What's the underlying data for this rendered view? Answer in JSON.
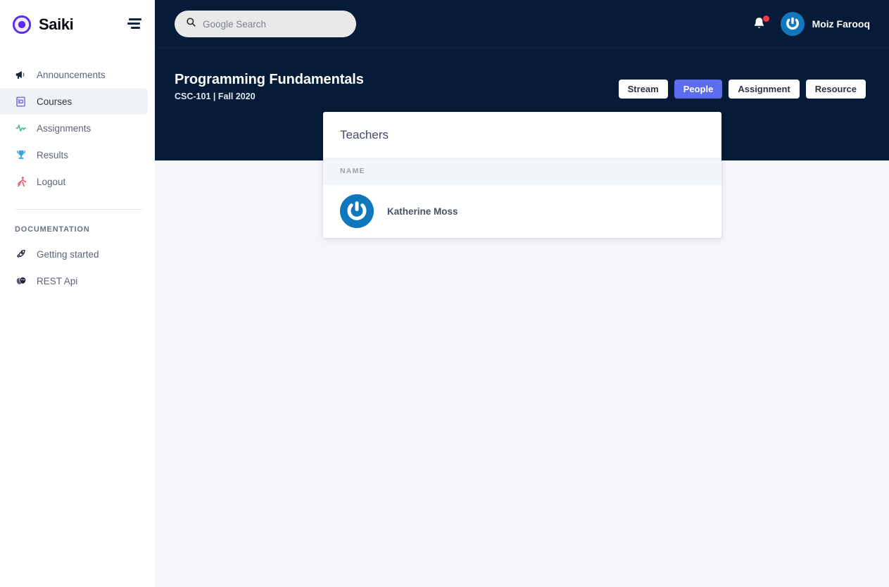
{
  "brand": {
    "name": "Saiki",
    "logo_icon": "aperture-logo-icon",
    "menu_icon": "hamburger-menu-icon"
  },
  "sidebar": {
    "items": [
      {
        "label": "Announcements",
        "icon": "megaphone-icon",
        "active": false
      },
      {
        "label": "Courses",
        "icon": "book-icon",
        "active": true
      },
      {
        "label": "Assignments",
        "icon": "activity-pulse-icon",
        "active": false
      },
      {
        "label": "Results",
        "icon": "trophy-icon",
        "active": false
      },
      {
        "label": "Logout",
        "icon": "running-person-icon",
        "active": false
      }
    ],
    "section_title": "DOCUMENTATION",
    "doc_items": [
      {
        "label": "Getting started",
        "icon": "rocket-icon"
      },
      {
        "label": "REST Api",
        "icon": "masks-icon"
      }
    ]
  },
  "topbar": {
    "search": {
      "value": "",
      "placeholder": "Google Search",
      "icon": "search-icon"
    },
    "notifications": {
      "icon": "bell-icon",
      "has_badge": true
    },
    "user": {
      "name": "Moiz Farooq",
      "avatar_icon": "power-avatar-icon"
    }
  },
  "course": {
    "title": "Programming Fundamentals",
    "subtitle": "CSC-101 | Fall 2020",
    "tabs": [
      {
        "label": "Stream",
        "active": false
      },
      {
        "label": "People",
        "active": true
      },
      {
        "label": "Assignment",
        "active": false
      },
      {
        "label": "Resource",
        "active": false
      }
    ]
  },
  "teachers_card": {
    "title": "Teachers",
    "columns": [
      "NAME"
    ],
    "rows": [
      {
        "name": "Katherine Moss",
        "avatar_icon": "power-avatar-icon"
      }
    ]
  },
  "colors": {
    "navy": "#061b38",
    "accent_indigo": "#5b6cf0",
    "brand_purple": "#5b2cf0",
    "avatar_blue": "#1077bc",
    "badge_red": "#f1394a",
    "content_bg": "#f5f6fb"
  }
}
